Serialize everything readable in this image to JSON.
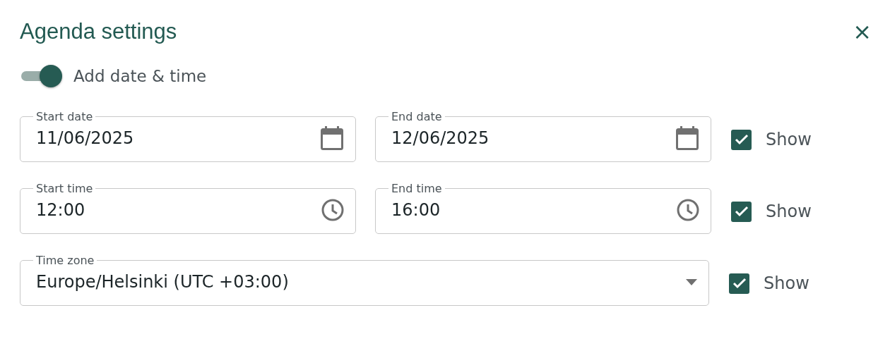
{
  "dialog": {
    "title": "Agenda settings",
    "close": "×"
  },
  "toggle": {
    "label": "Add date & time",
    "on": true
  },
  "rows": [
    {
      "fields": [
        {
          "kind": "date",
          "label": "Start date",
          "value": "11/06/2025"
        },
        {
          "kind": "date",
          "label": "End date",
          "value": "12/06/2025"
        }
      ],
      "show": {
        "label": "Show",
        "checked": true
      }
    },
    {
      "fields": [
        {
          "kind": "time",
          "label": "Start time",
          "value": "12:00"
        },
        {
          "kind": "time",
          "label": "End time",
          "value": "16:00"
        }
      ],
      "show": {
        "label": "Show",
        "checked": true
      }
    },
    {
      "fields": [
        {
          "kind": "select",
          "label": "Time zone",
          "value": "Europe/Helsinki (UTC +03:00)"
        }
      ],
      "show": {
        "label": "Show",
        "checked": true
      }
    }
  ]
}
